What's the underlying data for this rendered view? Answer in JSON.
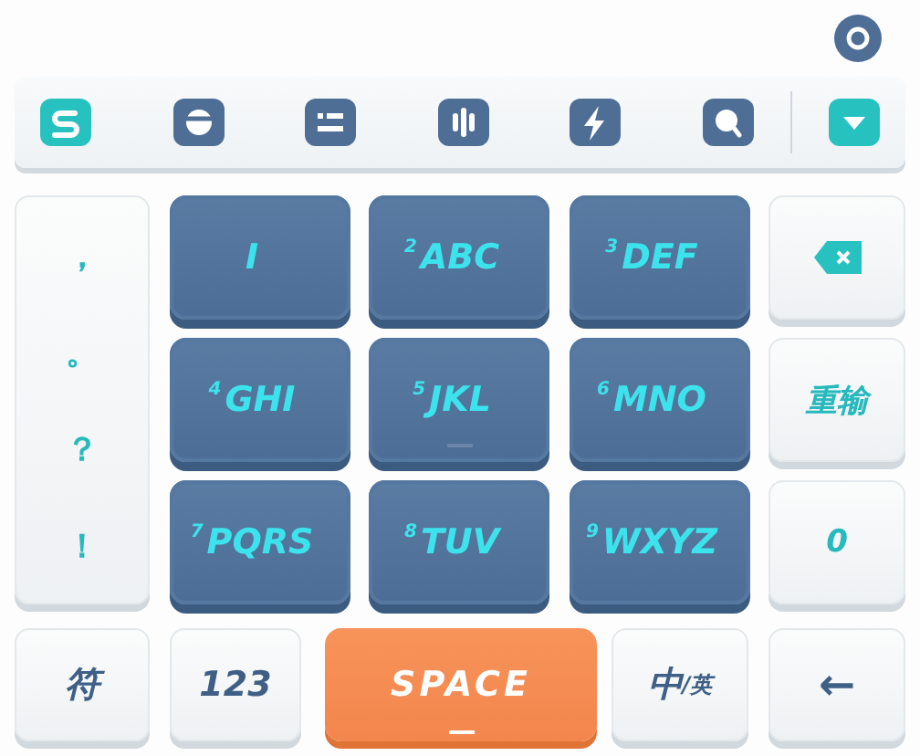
{
  "top_button": {
    "kind": "ring"
  },
  "toolbar": {
    "icons": [
      {
        "kind": "logo"
      },
      {
        "kind": "emoji"
      },
      {
        "kind": "list"
      },
      {
        "kind": "voice"
      },
      {
        "kind": "bolt"
      },
      {
        "kind": "search"
      }
    ],
    "collapse": {
      "kind": "triangle"
    }
  },
  "punctuation": [
    "，",
    "。",
    "？",
    "！"
  ],
  "keys": [
    {
      "letters": "I",
      "home_mark": false
    },
    {
      "number": "2",
      "letters": "ABC",
      "home_mark": false
    },
    {
      "number": "3",
      "letters": "DEF",
      "home_mark": false
    },
    {
      "number": "4",
      "letters": "GHI",
      "home_mark": false
    },
    {
      "number": "5",
      "letters": "JKL",
      "home_mark": true
    },
    {
      "number": "6",
      "letters": "MNO",
      "home_mark": false
    },
    {
      "number": "7",
      "letters": "PQRS",
      "home_mark": false
    },
    {
      "number": "8",
      "letters": "TUV",
      "home_mark": false
    },
    {
      "number": "9",
      "letters": "WXYZ",
      "home_mark": false
    }
  ],
  "side_keys": [
    {
      "kind": "delete"
    },
    {
      "kind": "text",
      "label": "重输"
    },
    {
      "kind": "text",
      "label": "0"
    }
  ],
  "bottom_keys": [
    {
      "kind": "white",
      "label": "符"
    },
    {
      "kind": "white",
      "label": "123"
    },
    {
      "kind": "space",
      "label": "SPACE"
    },
    {
      "kind": "lang",
      "label": "中",
      "sub": "/英"
    },
    {
      "kind": "white",
      "label": "←"
    }
  ]
}
